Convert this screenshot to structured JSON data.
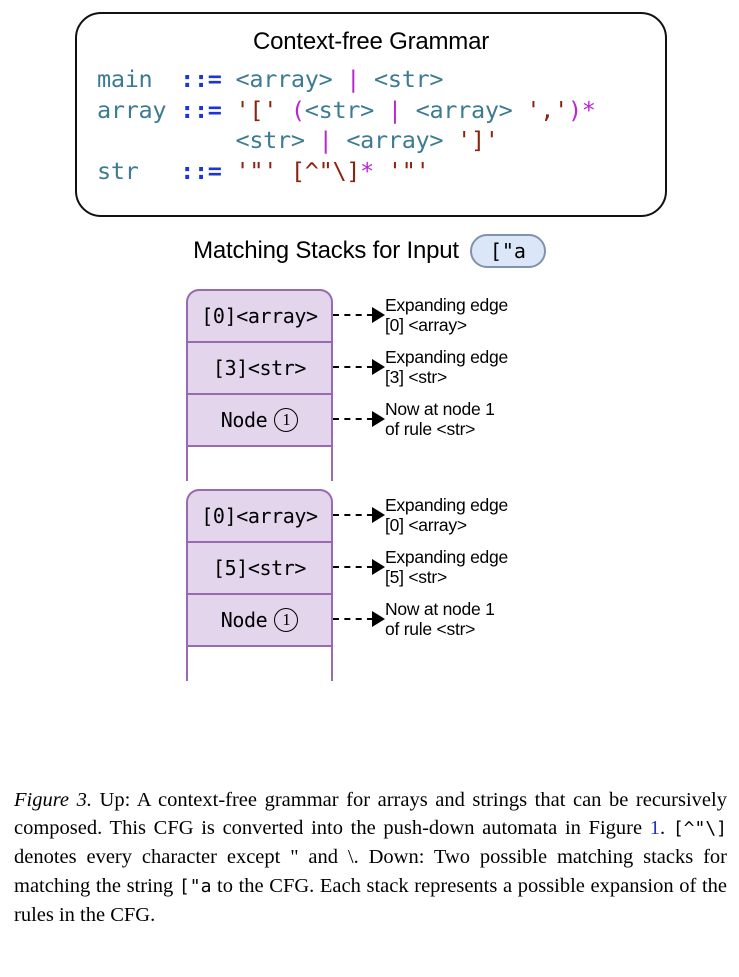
{
  "grammar_box": {
    "title": "Context-free Grammar",
    "rules": [
      {
        "head": "main",
        "def": "::=",
        "body_tokens": [
          {
            "t": "<array>",
            "k": "nt"
          },
          {
            "t": " ",
            "k": "plain"
          },
          {
            "t": "|",
            "k": "alt"
          },
          {
            "t": " ",
            "k": "plain"
          },
          {
            "t": "<str>",
            "k": "nt"
          }
        ]
      },
      {
        "head": "array",
        "def": "::=",
        "body_tokens": [
          {
            "t": "'['",
            "k": "lit"
          },
          {
            "t": " ",
            "k": "plain"
          },
          {
            "t": "(",
            "k": "op"
          },
          {
            "t": "<str>",
            "k": "nt"
          },
          {
            "t": " ",
            "k": "plain"
          },
          {
            "t": "|",
            "k": "alt"
          },
          {
            "t": " ",
            "k": "plain"
          },
          {
            "t": "<array>",
            "k": "nt"
          },
          {
            "t": " ",
            "k": "plain"
          },
          {
            "t": "','",
            "k": "lit"
          },
          {
            "t": ")",
            "k": "op"
          },
          {
            "t": "*",
            "k": "op"
          }
        ]
      },
      {
        "head": "",
        "def": "",
        "body_tokens": [
          {
            "t": "<str>",
            "k": "nt"
          },
          {
            "t": " ",
            "k": "plain"
          },
          {
            "t": "|",
            "k": "alt"
          },
          {
            "t": " ",
            "k": "plain"
          },
          {
            "t": "<array>",
            "k": "nt"
          },
          {
            "t": " ",
            "k": "plain"
          },
          {
            "t": "']'",
            "k": "lit"
          }
        ]
      },
      {
        "head": "str",
        "def": "::=",
        "body_tokens": [
          {
            "t": "'\"'",
            "k": "lit"
          },
          {
            "t": " ",
            "k": "plain"
          },
          {
            "t": "[^\"\\]",
            "k": "lit"
          },
          {
            "t": "*",
            "k": "op"
          },
          {
            "t": " ",
            "k": "plain"
          },
          {
            "t": "'\"'",
            "k": "lit"
          }
        ]
      }
    ],
    "raw_lines": [
      "main  ::= <array> | <str>",
      "array ::= '[' (<str> | <array> ',')*",
      "          <str> | <array> ']'",
      "str   ::= '\"' [^\"\\]* '\"'"
    ]
  },
  "stacks_section": {
    "heading": "Matching Stacks for Input",
    "input_badge": "[\"a"
  },
  "stacks": [
    {
      "id": "stack-1",
      "cells": [
        {
          "label": "[0]<array>",
          "kind": "frame"
        },
        {
          "label": "[3]<str>",
          "kind": "frame"
        },
        {
          "label": "Node",
          "circled": "1",
          "kind": "node"
        },
        {
          "label": "",
          "kind": "empty"
        }
      ],
      "annotations": [
        {
          "line1": "Expanding edge",
          "line2": "[0] <array>"
        },
        {
          "line1": "Expanding edge",
          "line2": "[3] <str>"
        },
        {
          "line1": "Now at node 1",
          "line2": "of rule <str>"
        }
      ]
    },
    {
      "id": "stack-2",
      "cells": [
        {
          "label": "[0]<array>",
          "kind": "frame"
        },
        {
          "label": "[5]<str>",
          "kind": "frame"
        },
        {
          "label": "Node",
          "circled": "1",
          "kind": "node"
        },
        {
          "label": "",
          "kind": "empty"
        }
      ],
      "annotations": [
        {
          "line1": "Expanding edge",
          "line2": "[0] <array>"
        },
        {
          "line1": "Expanding edge",
          "line2": "[5] <str>"
        },
        {
          "line1": "Now at node 1",
          "line2": "of rule <str>"
        }
      ]
    }
  ],
  "caption": {
    "figure_label": "Figure 3.",
    "part_1": " Up: A context-free grammar for arrays and strings that can be recursively composed. This CFG is converted into the push-down automata in Figure ",
    "reference_number": "1",
    "part_2": ". ",
    "charclass": "[^\"\\]",
    "part_3": " denotes every character except \" and \\. Down: Two possible matching stacks for matching the string ",
    "input_string": "[\"a",
    "part_4": " to the CFG. Each stack represents a possible expansion of the rules in the CFG.",
    "full_text": "Figure 3. Up: A context-free grammar for arrays and strings that can be recursively composed. This CFG is converted into the push-down automata in Figure 1. [^\"\\] denotes every character except \" and \\. Down: Two possible matching stacks for matching the string [\"a to the CFG. Each stack represents a possible expansion of the rules in the CFG."
  },
  "colors": {
    "nonterminal": "#3d7b93",
    "definition_op": "#1a36d8",
    "alternation": "#b925d1",
    "literal": "#8c2310",
    "operator": "#b925d1",
    "stack_fill": "#e2d5ec",
    "stack_border": "#9a6ab0",
    "badge_fill": "#dbe7f8",
    "badge_border": "#7f93ad",
    "reference_link": "#2233bb"
  }
}
